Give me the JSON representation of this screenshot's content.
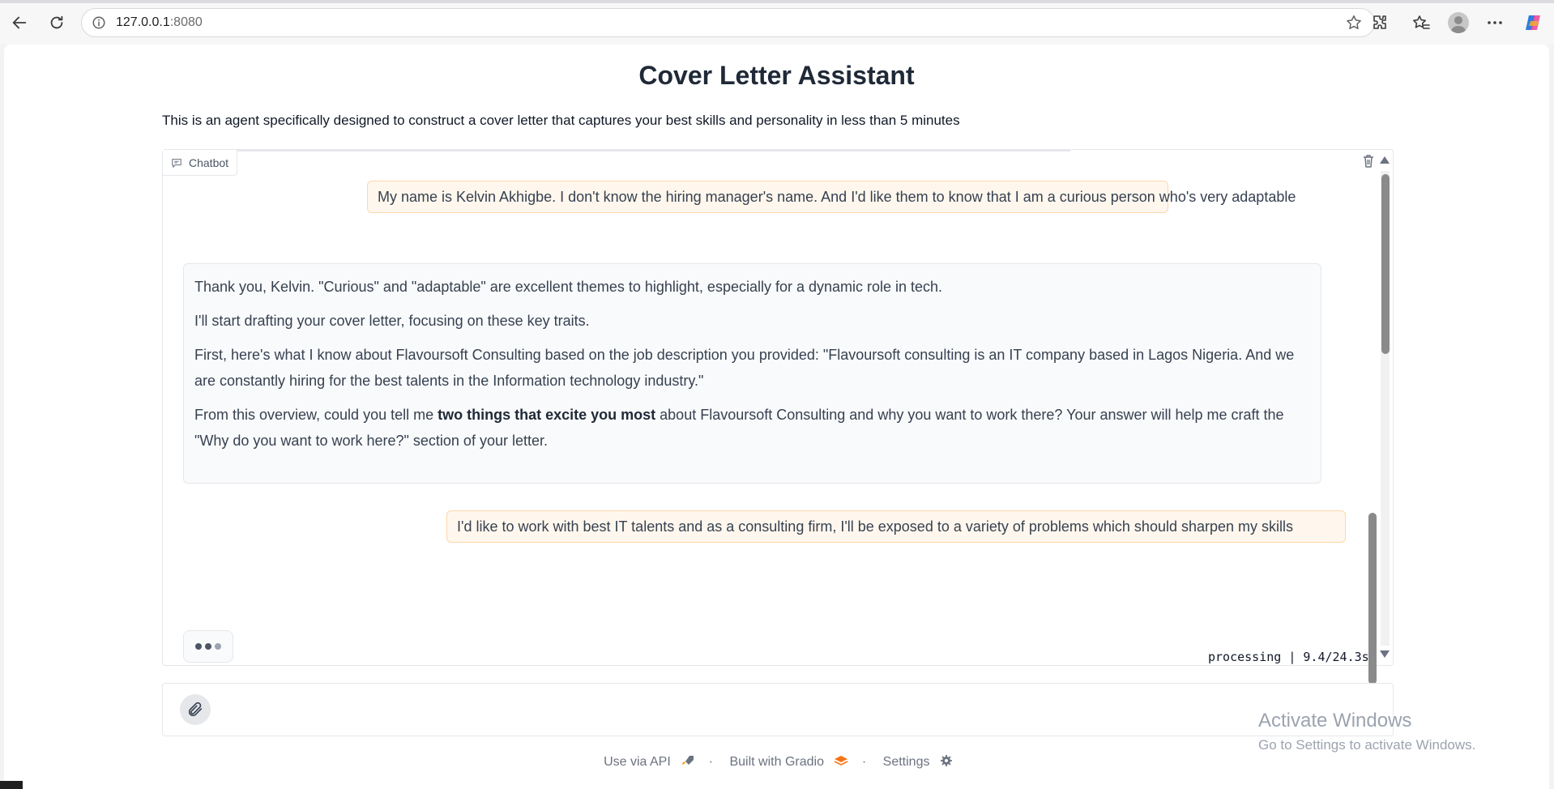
{
  "browser": {
    "url_host": "127.0.0.1",
    "url_port": ":8080"
  },
  "page": {
    "title": "Cover Letter Assistant",
    "description": "This is an agent specifically designed to construct a cover letter that captures your best skills and personality in less than 5 minutes"
  },
  "chatbot": {
    "label": "Chatbot",
    "messages": [
      {
        "role": "user",
        "text": "My name is Kelvin Akhigbe. I don't know the hiring manager's name. And I'd like them to know that I am a curious person who's very adaptable"
      },
      {
        "role": "assistant",
        "p1": "Thank you, Kelvin. \"Curious\" and \"adaptable\" are excellent themes to highlight, especially for a dynamic role in tech.",
        "p2": "I'll start drafting your cover letter, focusing on these key traits.",
        "p3": "First, here's what I know about Flavoursoft Consulting based on the job description you provided: \"Flavoursoft consulting is an IT company based in Lagos Nigeria. And we are constantly hiring for the best talents in the Information technology industry.\"",
        "p4_before": "From this overview, could you tell me ",
        "p4_bold": "two things that excite you most",
        "p4_after": " about Flavoursoft Consulting and why you want to work there? Your answer will help me craft the \"Why do you want to work here?\" section of your letter."
      },
      {
        "role": "user",
        "text": "I'd like to work with best IT talents and as a consulting firm, I'll be exposed to a variety of problems which should sharpen my skills"
      }
    ],
    "status": "processing | 9.4/24.3s"
  },
  "footer": {
    "api": "Use via API",
    "built": "Built with Gradio",
    "settings": "Settings",
    "separator": "·"
  },
  "watermark": {
    "line1": "Activate Windows",
    "line2": "Go to Settings to activate Windows."
  },
  "colors": {
    "user_bubble": "#fff7ed",
    "user_border": "#fed7aa",
    "bot_bubble": "#f9fafb"
  }
}
